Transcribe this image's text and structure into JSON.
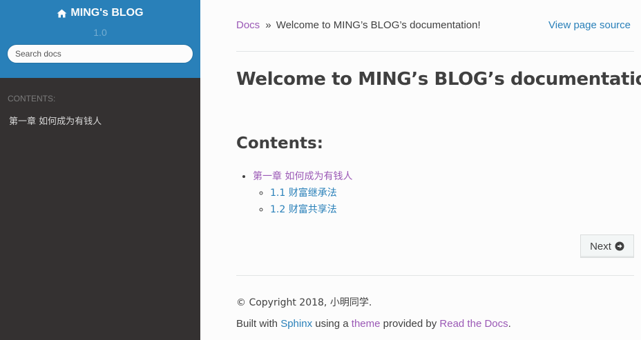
{
  "sidebar": {
    "brand": "MING's BLOG",
    "version": "1.0",
    "search_placeholder": "Search docs",
    "caption": "CONTENTS:",
    "items": [
      {
        "label": "第一章 如何成为有钱人"
      }
    ],
    "colors": {
      "top": "#2980b9",
      "bg": "#343131"
    },
    "brand_icon": "home-icon"
  },
  "breadcrumb": {
    "root": "Docs",
    "separator": "»",
    "current": "Welcome to MING’s BLOG’s documentation!",
    "view_source": "View page source"
  },
  "main": {
    "title": "Welcome to MING’s BLOG’s documentation!",
    "contents_heading": "Contents:",
    "toc": [
      {
        "label": "第一章 如何成为有钱人",
        "children": [
          {
            "label": "1.1 财富继承法"
          },
          {
            "label": "1.2 财富共享法"
          }
        ]
      }
    ],
    "next_label": "Next",
    "next_icon": "arrow-circle-right-icon"
  },
  "footer": {
    "copyright": "© Copyright 2018, 小明同学.",
    "built_prefix": "Built with",
    "sphinx": "Sphinx",
    "using_a": "using a",
    "theme": "theme",
    "provided_by": "provided by",
    "rtd": "Read the Docs",
    "period": "."
  },
  "colors": {
    "link": "#2980b9",
    "visited": "#9b59b6",
    "text": "#404040"
  }
}
